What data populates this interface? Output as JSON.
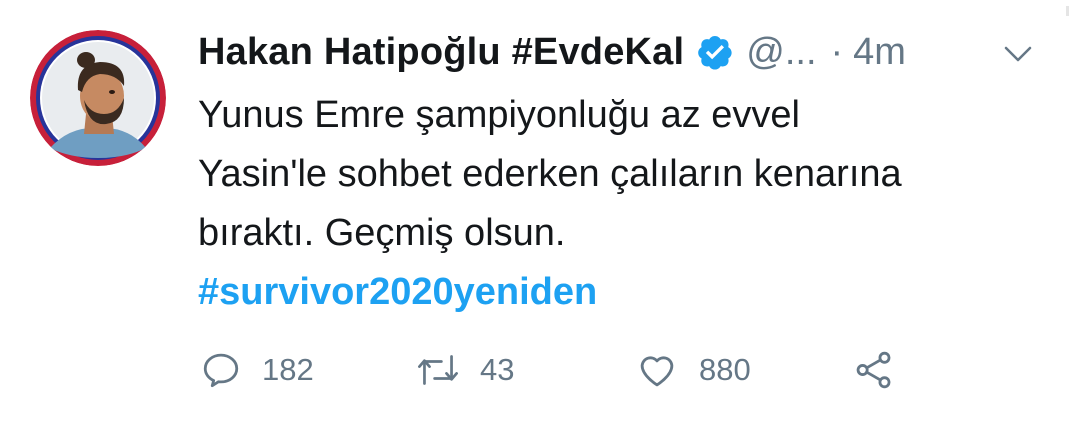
{
  "tweet": {
    "author": {
      "display_name": "Hakan Hatipoğlu #EvdeKal",
      "handle": "@...",
      "verified": true,
      "avatar_icon": "profile-photo"
    },
    "separator": "·",
    "time": "4m",
    "text_lines": [
      "Yunus Emre şampiyonluğu az evvel",
      "Yasin'le sohbet ederken çalıların kenarına",
      "bıraktı. Geçmiş olsun."
    ],
    "hashtag": "#survivor2020yeniden",
    "actions": {
      "reply_count": "182",
      "retweet_count": "43",
      "like_count": "880"
    },
    "icons": {
      "reply": "reply-icon",
      "retweet": "retweet-icon",
      "like": "heart-icon",
      "share": "share-icon",
      "more": "chevron-down-icon",
      "verified": "verified-badge-icon"
    }
  },
  "colors": {
    "text": "#14171a",
    "secondary": "#657786",
    "link": "#1da1f2",
    "verified": "#1da1f2",
    "avatar_ring_outer": "#c7203a",
    "avatar_ring_inner": "#27349a"
  }
}
